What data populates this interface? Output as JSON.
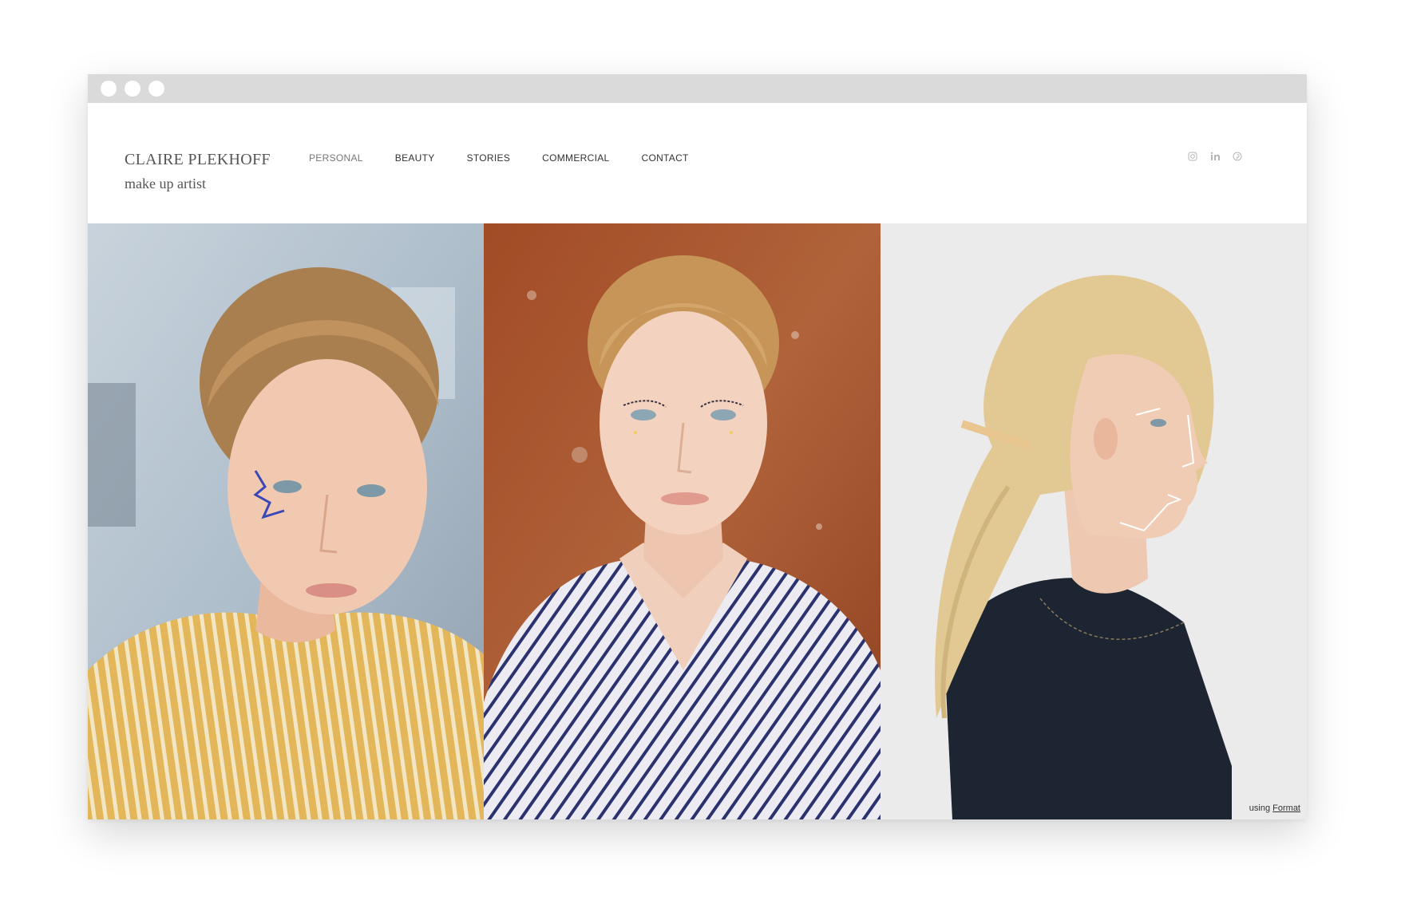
{
  "site": {
    "name": "CLAIRE PLEKHOFF",
    "tagline": "make up artist"
  },
  "nav": {
    "items": [
      {
        "label": "PERSONAL",
        "active": true
      },
      {
        "label": "BEAUTY",
        "active": false
      },
      {
        "label": "STORIES",
        "active": false
      },
      {
        "label": "COMMERCIAL",
        "active": false
      },
      {
        "label": "CONTACT",
        "active": false
      }
    ]
  },
  "social": {
    "icons": [
      "instagram-icon",
      "linkedin-icon",
      "pinterest-icon"
    ]
  },
  "gallery": {
    "photos": [
      {
        "name": "portrait-yellow-stripes",
        "bg": "#b8c6d2",
        "skin": "#f0c8b0",
        "hair": "#b88a58",
        "top": "#d8a64a"
      },
      {
        "name": "portrait-navy-stripes",
        "bg": "#a8562e",
        "skin": "#f2d0bc",
        "hair": "#c89a60",
        "top": "#e8e8ee"
      },
      {
        "name": "portrait-profile-dark-top",
        "bg": "#e9e9ea",
        "skin": "#f0ccb4",
        "hair": "#e6cf98",
        "top": "#1d2430"
      }
    ]
  },
  "credit": {
    "prefix": "using",
    "link": "Format"
  },
  "colors": {
    "titlebar": "#dadada",
    "text": "#555555"
  }
}
